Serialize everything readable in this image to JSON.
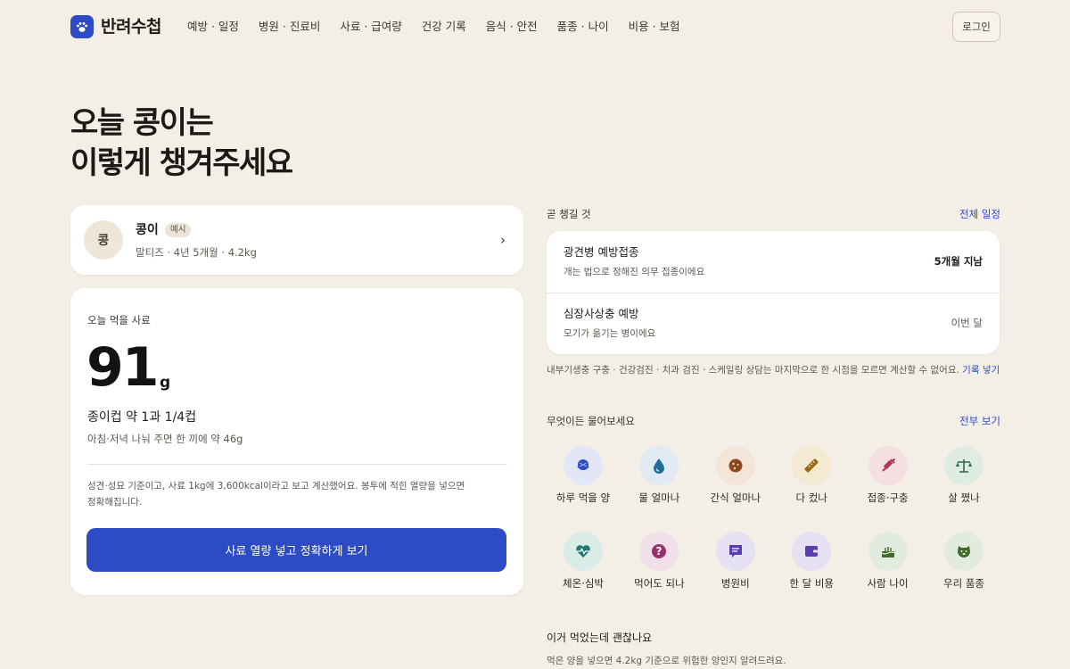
{
  "header": {
    "brand": "반려수첩",
    "nav": [
      "예방 · 일정",
      "병원 · 진료비",
      "사료 · 급여량",
      "건강 기록",
      "음식 · 안전",
      "품종 · 나이",
      "비용 · 보험"
    ],
    "login_label": "로그인"
  },
  "hero": {
    "line1": "오늘 콩이는",
    "line2": "이렇게 챙겨주세요"
  },
  "pet": {
    "avatar_text": "콩",
    "name": "콩이",
    "badge": "예시",
    "info": "말티즈 · 4년 5개월 · 4.2kg",
    "chevron": "›"
  },
  "food": {
    "title": "오늘 먹을 사료",
    "amount": "91",
    "unit": "g",
    "cups": "종이컵 약 1과 1/4컵",
    "split": "아침·저녁 나눠 주면 한 끼에 약 46g",
    "note_line1": "성견·성묘 기준이고, 사료 1kg에 3,600kcal이라고 보고 계산했어요. 봉투에 적힌 열량을 넣으면",
    "note_line2": "정확해집니다.",
    "button": "사료 열량 넣고 정확하게 보기"
  },
  "schedule": {
    "label": "곧 챙길 것",
    "link": "전체 일정",
    "items": [
      {
        "title": "광견병 예방접종",
        "desc": "개는 법으로 정해진 의무 접종이에요",
        "status": "5개월 지남"
      },
      {
        "title": "심장사상충 예방",
        "desc": "모기가 옮기는 병이에요",
        "status": "이번 달"
      }
    ],
    "footnote": "내부기생충 구충 · 건강검진 · 치과 검진 · 스케일링 상담는 마지막으로 한 시점을 모르면 계산할 수 없어요.",
    "footnote_link": "기록 넣기"
  },
  "ask": {
    "label": "무엇이든 물어보세요",
    "link": "전부 보기",
    "items": [
      {
        "label": "하루 먹을 양",
        "icon": "bowl-icon",
        "bg": "#e3e6f6",
        "color": "#2d4bc4"
      },
      {
        "label": "물 얼마나",
        "icon": "water-drop-icon",
        "bg": "#dfeaf2",
        "color": "#1f6f9a"
      },
      {
        "label": "간식 얼마나",
        "icon": "cookie-icon",
        "bg": "#f3e6d9",
        "color": "#8a4a1f"
      },
      {
        "label": "다 컸나",
        "icon": "ruler-icon",
        "bg": "#f4ead2",
        "color": "#9a6a12"
      },
      {
        "label": "접종·구충",
        "icon": "syringe-icon",
        "bg": "#f4dfe3",
        "color": "#b0355a"
      },
      {
        "label": "살 쪘나",
        "icon": "scale-icon",
        "bg": "#dfece4",
        "color": "#2f6a45"
      },
      {
        "label": "체온·심박",
        "icon": "heart-pulse-icon",
        "bg": "#d9ece8",
        "color": "#1f7a72"
      },
      {
        "label": "먹어도 되나",
        "icon": "question-icon",
        "bg": "#f1e0ea",
        "color": "#9a2f6a"
      },
      {
        "label": "병원비",
        "icon": "receipt-icon",
        "bg": "#e6e0f3",
        "color": "#5b3fb0"
      },
      {
        "label": "한 달 비용",
        "icon": "wallet-icon",
        "bg": "#e6e0f3",
        "color": "#5b3fb0"
      },
      {
        "label": "사람 나이",
        "icon": "cake-icon",
        "bg": "#e2ecde",
        "color": "#3f6a2a"
      },
      {
        "label": "우리 품종",
        "icon": "dog-face-icon",
        "bg": "#e2ecde",
        "color": "#3f6a2a"
      }
    ]
  },
  "safety": {
    "title": "이거 먹었는데 괜찮나요",
    "desc": "먹은 양을 넣으면 4.2kg 기준으로 위험한 양인지 알려드려요."
  }
}
